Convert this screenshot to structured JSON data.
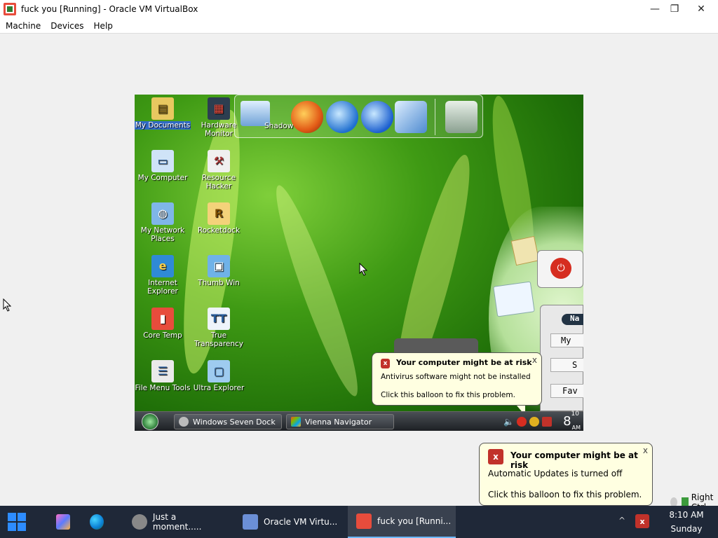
{
  "window": {
    "title": "fuck you [Running] - Oracle VM VirtualBox",
    "controls": {
      "minimize": "—",
      "maximize": "❐",
      "close": "✕"
    }
  },
  "menu": [
    "Machine",
    "Devices",
    "Help"
  ],
  "guest": {
    "desktop_icons": [
      "My Documents",
      "My Computer",
      "My Network Places",
      "Internet Explorer",
      "Core Temp",
      "File Menu Tools",
      "Hardware Monitor",
      "Resource Hacker",
      "Rocketdock",
      "Thumb Win",
      "True Transparency",
      "Ultra Explorer"
    ],
    "dock": {
      "label": "Shadow"
    },
    "gadget_buttons": [
      "Na",
      "My",
      "S",
      "Fav"
    ],
    "taskbar": {
      "tasks": [
        "Windows Seven Dock",
        "Vienna Navigator"
      ],
      "clock": {
        "hour": "8",
        "minute": "10",
        "ampm": "AM"
      }
    },
    "balloon": {
      "title": "Your computer might be at risk",
      "line1": "Antivirus software might not be installed",
      "line2": "Click this balloon to fix this problem.",
      "close": "x"
    }
  },
  "host_balloon": {
    "title": "Your computer might be at risk",
    "line1": "Automatic Updates is turned off",
    "line2": "Click this balloon to fix this problem.",
    "close": "x"
  },
  "right_ctrl": "Right Ctrl",
  "taskbar": {
    "apps": [
      "Just a moment.....",
      "Oracle VM Virtu...",
      "fuck you [Runni..."
    ],
    "time": "8:10 AM",
    "day": "Sunday"
  }
}
